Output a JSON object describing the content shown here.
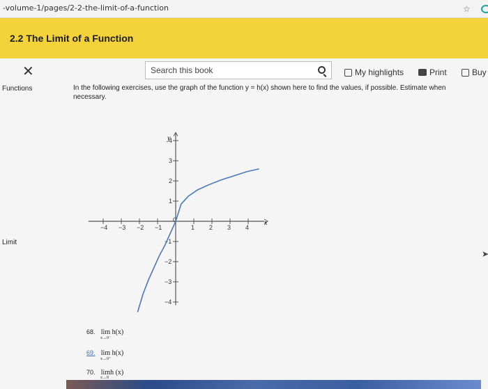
{
  "browser": {
    "url": "-volume-1/pages/2-2-the-limit-of-a-function",
    "star_icon": "star-icon"
  },
  "header": {
    "title": "2.2 The Limit of a Function"
  },
  "sidebar": {
    "close_icon": "close-icon",
    "items": [
      {
        "label": "Functions"
      },
      {
        "label": "Limit"
      }
    ]
  },
  "toolbar": {
    "search_placeholder": "Search this book",
    "highlights_label": "My highlights",
    "print_label": "Print",
    "buy_label": "Buy"
  },
  "main": {
    "intro": "In the following exercises, use the graph of the function y = h(x) shown here to find the values, if possible. Estimate when necessary.",
    "exercises": [
      {
        "number": "68.",
        "expr": "lim h(x)",
        "sub": "x→0⁻"
      },
      {
        "number": "69.",
        "expr": "lim h(x)",
        "sub": "x→0⁺"
      },
      {
        "number": "70.",
        "expr": "limh (x)",
        "sub": "x→0"
      }
    ]
  },
  "chart_data": {
    "type": "line",
    "xlabel": "x",
    "ylabel": "y",
    "xlim": [
      -4.5,
      4.5
    ],
    "ylim": [
      -4.5,
      4.5
    ],
    "x_ticks": [
      -4,
      -3,
      -2,
      -1,
      0,
      1,
      2,
      3,
      4
    ],
    "y_ticks": [
      -4,
      -3,
      -2,
      -1,
      1,
      2,
      3,
      4
    ],
    "origin_label": "0",
    "series": [
      {
        "color": "#4a78b8",
        "x": [
          -2.1,
          -1.8,
          -1.5,
          -1.2,
          -0.9,
          -0.6,
          -0.3,
          -0.1,
          0,
          0.3,
          0.7,
          1.2,
          1.8,
          2.5,
          3.2,
          3.9,
          4.6
        ],
        "y": [
          -4.5,
          -3.6,
          -2.9,
          -2.3,
          -1.7,
          -1.2,
          -0.6,
          -0.2,
          0,
          0.85,
          1.25,
          1.55,
          1.8,
          2.05,
          2.25,
          2.45,
          2.6
        ]
      }
    ]
  }
}
